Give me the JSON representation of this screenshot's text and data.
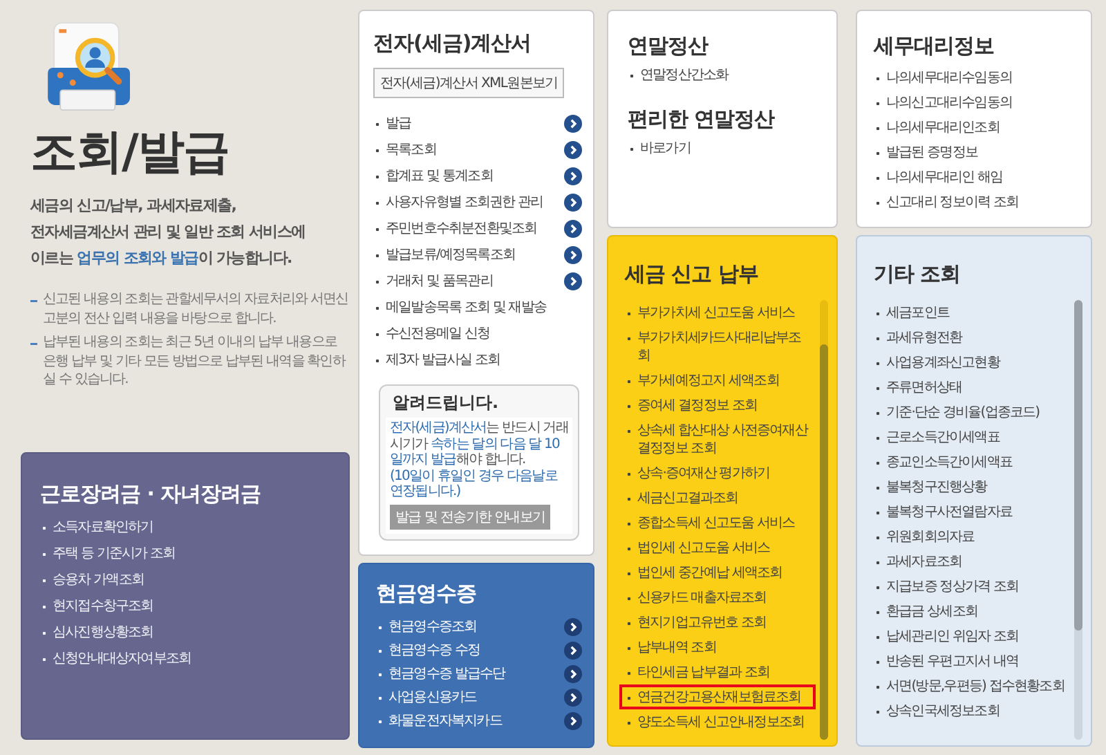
{
  "intro": {
    "title": "조회/발급",
    "description": "세금의 신고/납부, 과세자료제출,\n전자세금계산서 관리 및 일반 조회 서비스에\n이르는 **업무의 조회와 발급**이 가능합니다.",
    "notes": [
      "신고된 내용의 조회는 관할세무서의 자료처리와 서면신고분의 전산 입력 내용을 바탕으로 합니다.",
      "납부된 내용의 조회는 최근 5년 이내의 납부 내용으로 은행 납부 및 기타 모든 방법으로 납부된 내역을 확인하실 수 있습니다."
    ]
  },
  "incentive": {
    "title": "근로장려금 · 자녀장려금",
    "items": [
      "소득자료확인하기",
      "주택 등 기준시가 조회",
      "승용차 가액조회",
      "현지접수창구조회",
      "심사진행상황조회",
      "신청안내대상자여부조회"
    ]
  },
  "e_invoice": {
    "title": "전자(세금)계산서",
    "xml_button": "전자(세금)계산서 XML원본보기",
    "items": [
      {
        "label": "발급",
        "has_arrow": true
      },
      {
        "label": "목록조회",
        "has_arrow": true
      },
      {
        "label": "합계표 및 통계조회",
        "has_arrow": true
      },
      {
        "label": "사용자유형별 조회권한 관리",
        "has_arrow": true
      },
      {
        "label": "주민번호수취분전환및조회",
        "has_arrow": true
      },
      {
        "label": "발급보류/예정목록조회",
        "has_arrow": true
      },
      {
        "label": "거래처 및 품목관리",
        "has_arrow": true
      },
      {
        "label": "메일발송목록 조회 및 재발송",
        "has_arrow": false
      },
      {
        "label": "수신전용메일 신청",
        "has_arrow": false
      },
      {
        "label": "제3자 발급사실 조회",
        "has_arrow": false
      }
    ],
    "notice": {
      "title": "알려드립니다.",
      "text": "**전자(세금)계산서**는 반드시 거래시기가 **속하는 달의 다음 달 10일까지 발급**해야 합니다.",
      "note": "(10일이 휴일인 경우 다음날로 연장됩니다.)",
      "button": "발급 및 전송기한 안내보기"
    }
  },
  "cash_receipt": {
    "title": "현금영수증",
    "items": [
      "현금영수증조회",
      "현금영수증 수정",
      "현금영수증 발급수단",
      "사업용신용카드",
      "화물운전자복지카드"
    ]
  },
  "year_end": [
    {
      "title": "연말정산",
      "items": [
        "연말정산간소화"
      ]
    },
    {
      "title": "편리한 연말정산",
      "items": [
        "바로가기"
      ]
    }
  ],
  "tax_filing": {
    "title": "세금 신고 납부",
    "items": [
      {
        "label": "부가가치세 신고도움 서비스",
        "selected": false
      },
      {
        "label": "부가가치세카드사대리납부조회",
        "selected": false
      },
      {
        "label": "부가세예정고지 세액조회",
        "selected": false
      },
      {
        "label": "증여세 결정정보 조회",
        "selected": false
      },
      {
        "label": "상속세 합산대상 사전증여재산 결정정보 조회",
        "selected": false
      },
      {
        "label": "상속·증여재산 평가하기",
        "selected": false
      },
      {
        "label": "세금신고결과조회",
        "selected": false
      },
      {
        "label": "종합소득세 신고도움 서비스",
        "selected": false
      },
      {
        "label": "법인세 신고도움 서비스",
        "selected": false
      },
      {
        "label": "법인세 중간예납 세액조회",
        "selected": false
      },
      {
        "label": "신용카드 매출자료조회",
        "selected": false
      },
      {
        "label": "현지기업고유번호 조회",
        "selected": false
      },
      {
        "label": "납부내역 조회",
        "selected": false
      },
      {
        "label": "타인세금 납부결과 조회",
        "selected": false
      },
      {
        "label": "연금건강고용산재보험료조회",
        "selected": true
      },
      {
        "label": "양도소득세 신고안내정보조회",
        "selected": false
      }
    ]
  },
  "agent_info": {
    "title": "세무대리정보",
    "items": [
      "나의세무대리수임동의",
      "나의신고대리수임동의",
      "나의세무대리인조회",
      "발급된 증명정보",
      "나의세무대리인 해임",
      "신고대리 정보이력 조회"
    ]
  },
  "other": {
    "title": "기타 조회",
    "items": [
      "세금포인트",
      "과세유형전환",
      "사업용계좌신고현황",
      "주류면허상태",
      "기준·단순 경비율(업종코드)",
      "근로소득간이세액표",
      "종교인소득간이세액표",
      "불복청구진행상황",
      "불복청구사전열람자료",
      "위원회회의자료",
      "과세자료조회",
      "지급보증 정상가격 조회",
      "환급금 상세조회",
      "납세관리인 위임자 조회",
      "반송된 우편고지서 내역",
      "서면(방문,우편등) 접수현황조회",
      "상속인국세정보조회"
    ]
  }
}
